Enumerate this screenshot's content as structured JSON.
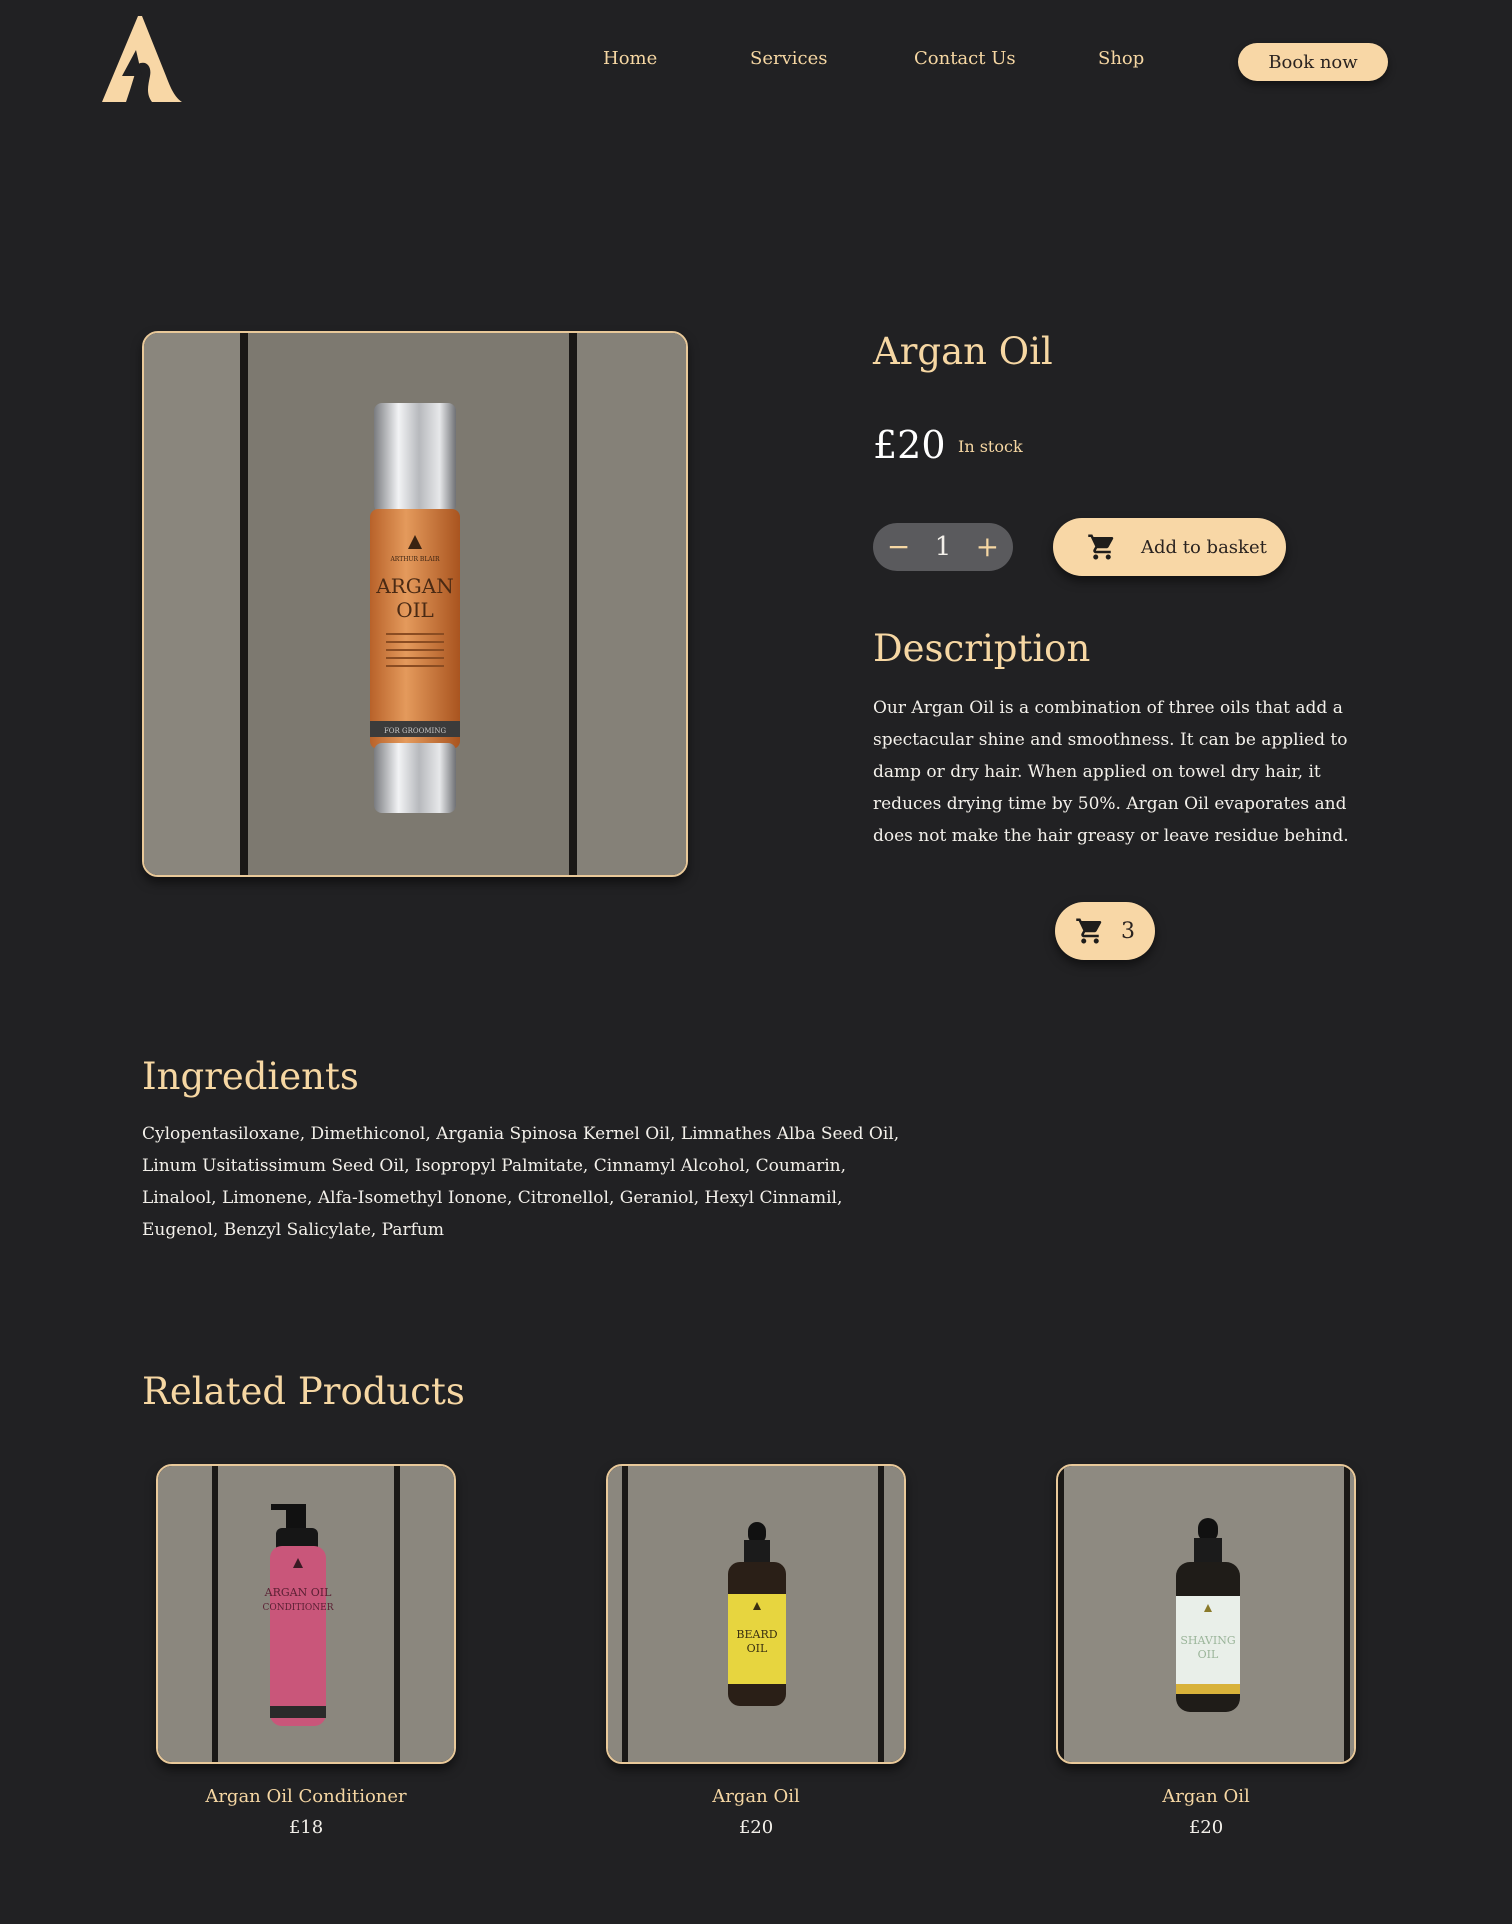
{
  "header": {
    "nav": [
      "Home",
      "Services",
      "Contact Us",
      "Shop"
    ],
    "book_label": "Book now"
  },
  "product": {
    "title": "Argan Oil",
    "price": "£20",
    "stock": "In stock",
    "quantity": "1",
    "qty_minus": "−",
    "qty_plus": "+",
    "add_label": "Add to basket",
    "image_label": {
      "brand": "ARTHUR BLAIR",
      "name_line1": "ARGAN",
      "name_line2": "OIL",
      "footer": "FOR GROOMING"
    }
  },
  "description": {
    "title": "Description",
    "text": "Our Argan Oil is a combination of three oils that add a spectacular shine and smoothness. It can be applied to damp or dry hair. When applied on towel dry hair, it reduces drying time by 50%. Argan Oil evaporates and does not make the hair greasy or leave residue behind."
  },
  "cart": {
    "count": "3"
  },
  "ingredients": {
    "title": "Ingredients",
    "text": "Cylopentasiloxane, Dimethiconol, Argania Spinosa Kernel Oil, Limnathes Alba Seed Oil, Linum Usitatissimum Seed Oil, Isopropyl Palmitate, Cinnamyl Alcohol, Coumarin, Linalool, Limonene, Alfa-Isomethyl Ionone, Citronellol, Geraniol, Hexyl Cinnamil, Eugenol, Benzyl Salicylate, Parfum"
  },
  "related": {
    "title": "Related Products",
    "items": [
      {
        "name": "Argan Oil Conditioner",
        "price": "£18",
        "label_line1": "ARGAN OIL",
        "label_line2": "CONDITIONER"
      },
      {
        "name": "Argan Oil",
        "price": "£20",
        "label_line1": "BEARD",
        "label_line2": "OIL"
      },
      {
        "name": "Argan Oil",
        "price": "£20",
        "label_line1": "SHAVING",
        "label_line2": "OIL"
      }
    ]
  },
  "colors": {
    "background": "#212123",
    "accent": "#f8d7a6",
    "accent_text": "#f6d7a3",
    "qty_box": "#5a5a5d"
  }
}
